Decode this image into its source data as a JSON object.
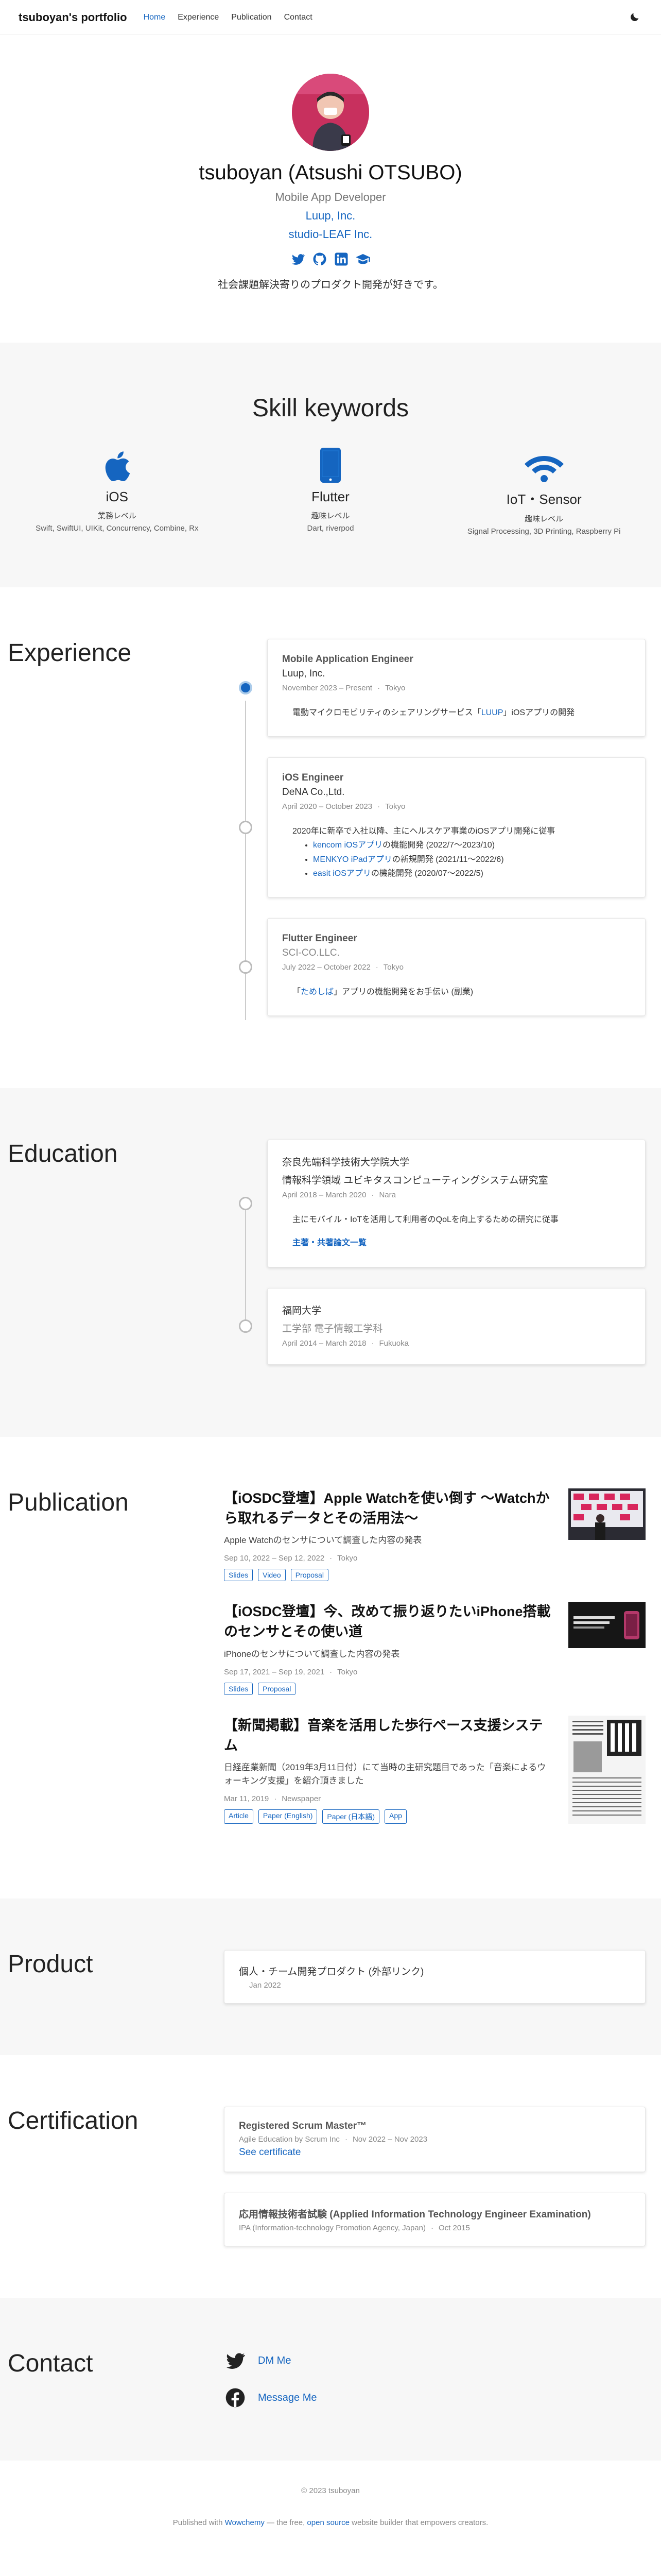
{
  "nav": {
    "brand": "tsuboyan's portfolio",
    "links": [
      "Home",
      "Experience",
      "Publication",
      "Contact"
    ]
  },
  "hero": {
    "name": "tsuboyan (Atsushi OTSUBO)",
    "role": "Mobile App Developer",
    "orgs": [
      "Luup, Inc.",
      "studio-LEAF Inc."
    ],
    "bio": "社会課題解決寄りのプロダクト開発が好きです。"
  },
  "skills": {
    "title": "Skill keywords",
    "items": [
      {
        "name": "iOS",
        "level": "業務レベル",
        "desc": "Swift, SwiftUI, UIKit, Concurrency, Combine, Rx"
      },
      {
        "name": "Flutter",
        "level": "趣味レベル",
        "desc": "Dart, riverpod"
      },
      {
        "name": "IoT・Sensor",
        "level": "趣味レベル",
        "desc": "Signal Processing, 3D Printing, Raspberry Pi"
      }
    ]
  },
  "experience": {
    "title": "Experience",
    "items": [
      {
        "role": "Mobile Application Engineer",
        "org": "Luup, Inc.",
        "period": "November 2023 – Present",
        "location": "Tokyo",
        "body_pre": "電動マイクロモビリティのシェアリングサービス「",
        "body_link": "LUUP",
        "body_post": "」iOSアプリの開発"
      },
      {
        "role": "iOS Engineer",
        "org": "DeNA Co.,Ltd.",
        "period": "April 2020 – October 2023",
        "location": "Tokyo",
        "body_intro": "2020年に新卒で入社以降、主にヘルスケア事業のiOSアプリ開発に従事",
        "list": [
          {
            "link": "kencom iOSアプリ",
            "text": "の機能開発 (2022/7〜2023/10)"
          },
          {
            "link": "MENKYO iPadアプリ",
            "text": "の新規開発 (2021/11〜2022/6)"
          },
          {
            "link": "easit iOSアプリ",
            "text": "の機能開発 (2020/07〜2022/5)"
          }
        ]
      },
      {
        "role": "Flutter Engineer",
        "org": "SCI-CO.LLC.",
        "period": "July 2022 – October 2022",
        "location": "Tokyo",
        "body_pre": "「",
        "body_link": "ためしば",
        "body_post": "」アプリの機能開発をお手伝い (副業)"
      }
    ]
  },
  "education": {
    "title": "Education",
    "items": [
      {
        "school": "奈良先端科学技術大学院大学",
        "dept": "情報科学領域 ユビキタスコンピューティングシステム研究室",
        "period": "April 2018 – March 2020",
        "location": "Nara",
        "body": "主にモバイル・IoTを活用して利用者のQoLを向上するための研究に従事",
        "link": "主著・共著論文一覧"
      },
      {
        "school": "福岡大学",
        "dept": "工学部 電子情報工学科",
        "period": "April 2014 – March 2018",
        "location": "Fukuoka"
      }
    ]
  },
  "publication": {
    "title": "Publication",
    "items": [
      {
        "title": "【iOSDC登壇】Apple Watchを使い倒す 〜Watchから取れるデータとその活用法〜",
        "summary": "Apple Watchのセンサについて調査した内容の発表",
        "date": "Sep 10, 2022 – Sep 12, 2022",
        "location": "Tokyo",
        "tags": [
          "Slides",
          "Video",
          "Proposal"
        ]
      },
      {
        "title": "【iOSDC登壇】今、改めて振り返りたいiPhone搭載のセンサとその使い道",
        "summary": "iPhoneのセンサについて調査した内容の発表",
        "date": "Sep 17, 2021 – Sep 19, 2021",
        "location": "Tokyo",
        "tags": [
          "Slides",
          "Proposal"
        ]
      },
      {
        "title": "【新聞掲載】音楽を活用した歩行ペース支援システム",
        "summary": "日経産業新聞（2019年3月11日付）にて当時の主研究題目であった「音楽によるウォーキング支援」を紹介頂きました",
        "date": "Mar 11, 2019",
        "location": "Newspaper",
        "tags": [
          "Article",
          "Paper (English)",
          "Paper (日本語)",
          "App"
        ]
      }
    ]
  },
  "product": {
    "title": "Product",
    "item": {
      "title": "個人・チーム開発プロダクト (外部リンク)",
      "date": "Jan 2022"
    }
  },
  "certification": {
    "title": "Certification",
    "items": [
      {
        "title": "Registered Scrum Master™",
        "issuer": "Agile Education by Scrum Inc",
        "period": "Nov 2022 – Nov 2023",
        "link": "See certificate"
      },
      {
        "title": "応用情報技術者試験 (Applied Information Technology Engineer Examination)",
        "issuer": "IPA (Information-technology Promotion Agency, Japan)",
        "period": "Oct 2015"
      }
    ]
  },
  "contact": {
    "title": "Contact",
    "items": [
      "DM Me",
      "Message Me"
    ]
  },
  "footer": {
    "copyright": "© 2023 tsuboyan",
    "pre": "Published with ",
    "link1": "Wowchemy",
    "mid": " — the free, ",
    "link2": "open source",
    "post": " website builder that empowers creators."
  },
  "colors": {
    "accent": "#1565c0",
    "section_gray": "#f7f7f7",
    "avatar_bg": "#c12a5a"
  }
}
